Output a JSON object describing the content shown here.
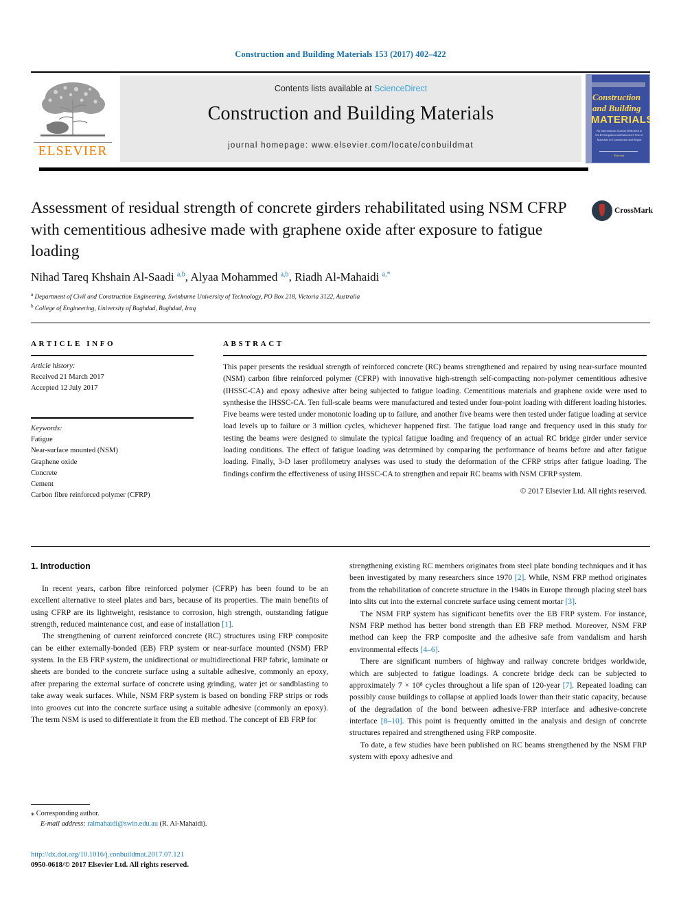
{
  "running_head": "Construction and Building Materials 153 (2017) 402–422",
  "header": {
    "publisher_name": "ELSEVIER",
    "contents_prefix": "Contents lists available at ",
    "sciencedirect": "ScienceDirect",
    "journal_name": "Construction and Building Materials",
    "homepage": "journal homepage: www.elsevier.com/locate/conbuildmat",
    "cover": {
      "line1": "Construction",
      "line2": "and Building",
      "line3": "MATERIALS",
      "subtitle": "An International Journal Dedicated to the Investigation and Innovative Use of Materials in Construction and Repair",
      "footer": "Elsevier"
    }
  },
  "article": {
    "title": "Assessment of residual strength of concrete girders rehabilitated using NSM CFRP with cementitious adhesive made with graphene oxide after exposure to fatigue loading",
    "crossmark_label": "CrossMark",
    "authors_html": "Nihad Tareq Khshain Al-Saadi <sup>a,b</sup>, Alyaa Mohammed <sup>a,b</sup>, Riadh Al-Mahaidi <sup>a,*</sup>",
    "affiliation_a": "Department of Civil and Construction Engineering, Swinburne University of Technology, PO Box 218, Victoria 3122, Australia",
    "affiliation_b": "College of Engineering, University of Baghdad, Baghdad, Iraq"
  },
  "article_info": {
    "heading": "ARTICLE INFO",
    "history_label": "Article history:",
    "received": "Received 21 March 2017",
    "accepted": "Accepted 12 July 2017",
    "keywords_label": "Keywords:",
    "keywords": [
      "Fatigue",
      "Near-surface mounted (NSM)",
      "Graphene oxide",
      "Concrete",
      "Cement",
      "Carbon fibre reinforced polymer (CFRP)"
    ]
  },
  "abstract": {
    "heading": "ABSTRACT",
    "text": "This paper presents the residual strength of reinforced concrete (RC) beams strengthened and repaired by using near-surface mounted (NSM) carbon fibre reinforced polymer (CFRP) with innovative high-strength self-compacting non-polymer cementitious adhesive (IHSSC-CA) and epoxy adhesive after being subjected to fatigue loading. Cementitious materials and graphene oxide were used to synthesise the IHSSC-CA. Ten full-scale beams were manufactured and tested under four-point loading with different loading histories. Five beams were tested under monotonic loading up to failure, and another five beams were then tested under fatigue loading at service load levels up to failure or 3 million cycles, whichever happened first. The fatigue load range and frequency used in this study for testing the beams were designed to simulate the typical fatigue loading and frequency of an actual RC bridge girder under service loading conditions. The effect of fatigue loading was determined by comparing the performance of beams before and after fatigue loading. Finally, 3-D laser profilometry analyses was used to study the deformation of the CFRP strips after fatigue loading. The findings confirm the effectiveness of using IHSSC-CA to strengthen and repair RC beams with NSM CFRP system.",
    "copyright": "© 2017 Elsevier Ltd. All rights reserved."
  },
  "body": {
    "section_heading": "1. Introduction",
    "left_paragraphs": [
      "In recent years, carbon fibre reinforced polymer (CFRP) has been found to be an excellent alternative to steel plates and bars, because of its properties. The main benefits of using CFRP are its lightweight, resistance to corrosion, high strength, outstanding fatigue strength, reduced maintenance cost, and ease of installation [1].",
      "The strengthening of current reinforced concrete (RC) structures using FRP composite can be either externally-bonded (EB) FRP system or near-surface mounted (NSM) FRP system. In the EB FRP system, the unidirectional or multidirectional FRP fabric, laminate or sheets are bonded to the concrete surface using a suitable adhesive, commonly an epoxy, after preparing the external surface of concrete using grinding, water jet or sandblasting to take away weak surfaces. While, NSM FRP system is based on bonding FRP strips or rods into grooves cut into the concrete surface using a suitable adhesive (commonly an epoxy). The term NSM is used to differentiate it from the EB method. The concept of EB FRP for"
    ],
    "right_paragraphs": [
      "strengthening existing RC members originates from steel plate bonding techniques and it has been investigated by many researchers since 1970 [2]. While, NSM FRP method originates from the rehabilitation of concrete structure in the 1940s in Europe through placing steel bars into slits cut into the external concrete surface using cement mortar [3].",
      "The NSM FRP system has significant benefits over the EB FRP system. For instance, NSM FRP method has better bond strength than EB FRP method. Moreover, NSM FRP method can keep the FRP composite and the adhesive safe from vandalism and harsh environmental effects [4–6].",
      "There are significant numbers of highway and railway concrete bridges worldwide, which are subjected to fatigue loadings. A concrete bridge deck can be subjected to approximately 7 × 10⁸ cycles throughout a life span of 120-year [7]. Repeated loading can possibly cause buildings to collapse at applied loads lower than their static capacity, because of the degradation of the bond between adhesive-FRP interface and adhesive-concrete interface [8–10]. This point is frequently omitted in the analysis and design of concrete structures repaired and strengthened using FRP composite.",
      "To date, a few studies have been published on RC beams strengthened by the NSM FRP system with epoxy adhesive and"
    ]
  },
  "footnotes": {
    "corresponding_marker": "⁎",
    "corresponding_text": "Corresponding author.",
    "email_label": "E-mail address:",
    "email": "ralmahaidi@swin.edu.au",
    "email_owner": "(R. Al-Mahaidi).",
    "doi": "http://dx.doi.org/10.1016/j.conbuildmat.2017.07.121",
    "issn": "0950-0618/© 2017 Elsevier Ltd. All rights reserved."
  },
  "colors": {
    "link": "#1a78b0",
    "elsevier_orange": "#f07d00",
    "sciencedirect": "#3aa5d8",
    "cover_blue": "#3b4fa0",
    "cover_yellow": "#ffd84d"
  }
}
